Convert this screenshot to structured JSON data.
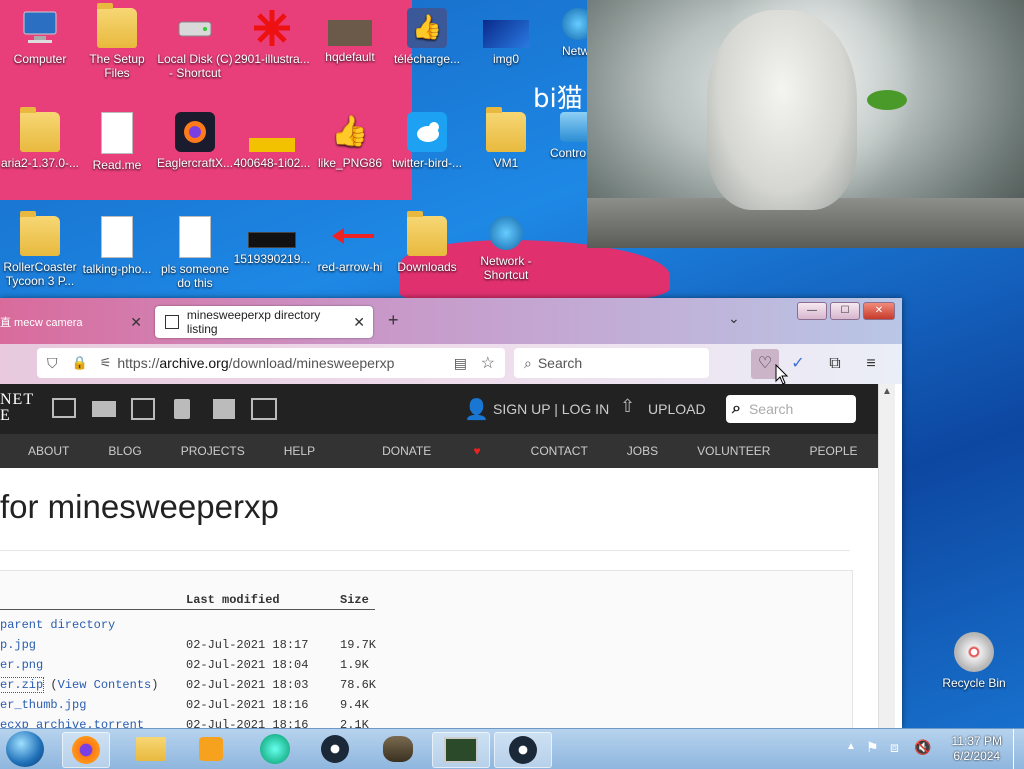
{
  "desktop": {
    "overlay_text": "bi猫",
    "icons": [
      {
        "label": "Computer",
        "icon": "computer-icon"
      },
      {
        "label": "The Setup Files",
        "icon": "folder-icon"
      },
      {
        "label": "Local Disk (C) - Shortcut",
        "icon": "drive-icon"
      },
      {
        "label": "2901-illustra...",
        "icon": "red-star-icon"
      },
      {
        "label": "hqdefault",
        "icon": "image-icon"
      },
      {
        "label": "télécharge...",
        "icon": "thumbs-up-icon"
      },
      {
        "label": "img0",
        "icon": "image-icon"
      },
      {
        "label": "Netw...",
        "icon": "network-icon"
      },
      {
        "label": "aria2-1.37.0-...",
        "icon": "folder-icon"
      },
      {
        "label": "Read.me",
        "icon": "document-icon"
      },
      {
        "label": "EaglercraftX...",
        "icon": "firefox-icon"
      },
      {
        "label": "400648-1i02...",
        "icon": "image-icon"
      },
      {
        "label": "like_PNG86",
        "icon": "thumbs-up-icon"
      },
      {
        "label": "twitter-bird-...",
        "icon": "twitter-icon"
      },
      {
        "label": "VM1",
        "icon": "folder-user-icon"
      },
      {
        "label": "Contro...",
        "icon": "control-panel-icon"
      },
      {
        "label": "RollerCoaster Tycoon 3 P...",
        "icon": "folder-icon"
      },
      {
        "label": "talking-pho...",
        "icon": "document-icon"
      },
      {
        "label": "pls someone do this",
        "icon": "document-icon"
      },
      {
        "label": "1519390219...",
        "icon": "image-icon"
      },
      {
        "label": "red-arrow-hi",
        "icon": "red-arrow-icon"
      },
      {
        "label": "Downloads",
        "icon": "folder-icon"
      },
      {
        "label": "Network - Shortcut",
        "icon": "network-icon"
      },
      {
        "label": "Recycle Bin",
        "icon": "recycle-bin-icon"
      }
    ]
  },
  "browser": {
    "tabs": [
      {
        "label": "直 mecw camera"
      },
      {
        "label": "minesweeperxp directory listing"
      }
    ],
    "url_prefix": "https://",
    "url_domain": "archive.org",
    "url_path": "/download/minesweeperxp",
    "search_placeholder": "Search",
    "window_buttons": {
      "minimize": "—",
      "maximize": "☐",
      "close": "✕"
    }
  },
  "archive": {
    "logo_line1": "NET",
    "logo_line2": "E",
    "signup": "SIGN UP | LOG IN",
    "upload": "UPLOAD",
    "search_placeholder": "Search",
    "nav": [
      "ABOUT",
      "BLOG",
      "PROJECTS",
      "HELP",
      "DONATE",
      "CONTACT",
      "JOBS",
      "VOLUNTEER",
      "PEOPLE"
    ],
    "heading": "for minesweeperxp",
    "table": {
      "col_modified": "Last modified",
      "col_size": "Size",
      "parent": "parent directory",
      "rows": [
        {
          "name": "p.jpg",
          "modified": "02-Jul-2021 18:17",
          "size": "19.7K",
          "extra": ""
        },
        {
          "name": "er.png",
          "modified": "02-Jul-2021 18:04",
          "size": "1.9K",
          "extra": ""
        },
        {
          "name": "er.zip",
          "modified": "02-Jul-2021 18:03",
          "size": "78.6K",
          "extra": "View Contents"
        },
        {
          "name": "er_thumb.jpg",
          "modified": "02-Jul-2021 18:16",
          "size": "9.4K",
          "extra": ""
        },
        {
          "name": "ecxp_archive.torrent",
          "modified": "02-Jul-2021 18:16",
          "size": "2.1K",
          "extra": ""
        }
      ]
    }
  },
  "taskbar": {
    "time": "11:37 PM",
    "date": "6/2/2024"
  }
}
